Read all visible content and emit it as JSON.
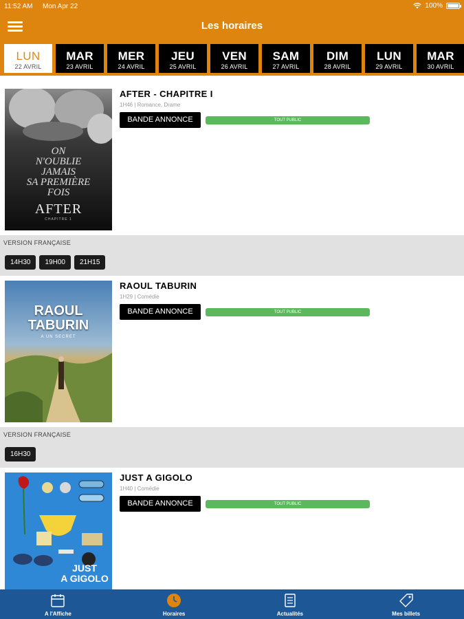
{
  "status_bar": {
    "time": "11:52 AM",
    "date": "Mon Apr 22",
    "battery": "100%",
    "battery_level": 1.0
  },
  "header": {
    "title": "Les horaires"
  },
  "day_tabs": [
    {
      "day": "LUN",
      "date": "22 AVRIL",
      "active": true
    },
    {
      "day": "MAR",
      "date": "23 AVRIL"
    },
    {
      "day": "MER",
      "date": "24 AVRIL"
    },
    {
      "day": "JEU",
      "date": "25 AVRIL"
    },
    {
      "day": "VEN",
      "date": "26 AVRIL"
    },
    {
      "day": "SAM",
      "date": "27 AVRIL"
    },
    {
      "day": "DIM",
      "date": "28 AVRIL"
    },
    {
      "day": "LUN",
      "date": "29 AVRIL"
    },
    {
      "day": "MAR",
      "date": "30 AVRIL"
    }
  ],
  "movies": [
    {
      "title": "AFTER - CHAPITRE I",
      "meta": "1H46 | Romance, Drame",
      "trailer_label": "BANDE ANNONCE",
      "rating": "TOUT PUBLIC",
      "version": "VERSION FRANÇAISE",
      "times": [
        "14H30",
        "19H00",
        "21H15"
      ],
      "poster": {
        "title": "AFTER",
        "subtitle": "CHAPITRE 1",
        "tagline": [
          "ON",
          "N'OUBLIE",
          "JAMAIS",
          "SA PREMIÈRE",
          "FOIS"
        ]
      }
    },
    {
      "title": "RAOUL TABURIN",
      "meta": "1H29 | Comédie",
      "trailer_label": "BANDE ANNONCE",
      "rating": "TOUT PUBLIC",
      "version": "VERSION FRANÇAISE",
      "times": [
        "16H30"
      ],
      "poster": {
        "title_lines": [
          "RAOUL",
          "TABURIN"
        ],
        "subtitle": "A UN SECRET"
      }
    },
    {
      "title": "JUST A GIGOLO",
      "meta": "1H40 | Comédie",
      "trailer_label": "BANDE ANNONCE",
      "rating": "TOUT PUBLIC",
      "poster": {
        "title_lines": [
          "JUST",
          "A GIGOLO"
        ]
      }
    }
  ],
  "bottom_nav": [
    {
      "label": "A l'Affiche",
      "icon": "calendar-icon"
    },
    {
      "label": "Horaires",
      "icon": "clock-icon",
      "active": true,
      "active_color": "#de8510"
    },
    {
      "label": "Actualités",
      "icon": "news-icon"
    },
    {
      "label": "Mes billets",
      "icon": "ticket-icon"
    }
  ],
  "colors": {
    "brand_orange": "#de8510",
    "nav_blue": "#1d5795",
    "rating_green": "#5cb85c"
  }
}
